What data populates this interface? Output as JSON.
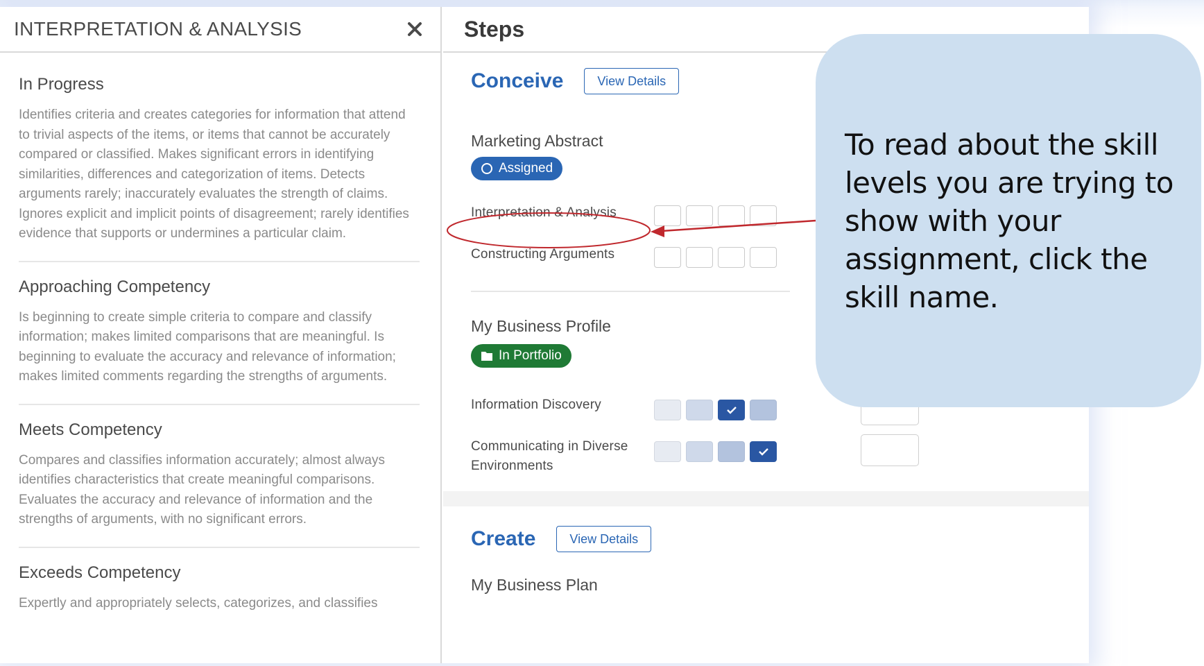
{
  "left_panel": {
    "title": "INTERPRETATION & ANALYSIS",
    "close_icon": "close-icon",
    "levels": [
      {
        "name": "In Progress",
        "description": "Identifies criteria and creates categories for information that attend to trivial aspects of the items, or items that cannot be accurately compared or classified. Makes significant errors in identifying similarities, differences and categorization of items. Detects arguments rarely; inaccurately evaluates the strength of claims. Ignores explicit and implicit points of disagreement; rarely identifies evidence that supports or undermines a particular claim."
      },
      {
        "name": "Approaching Competency",
        "description": "Is beginning to create simple criteria to compare and classify information; makes limited comparisons that are meaningful. Is beginning to evaluate the accuracy and relevance of information; makes limited comments regarding the strengths of arguments."
      },
      {
        "name": "Meets Competency",
        "description": "Compares and classifies information accurately; almost always identifies characteristics that create meaningful comparisons. Evaluates the accuracy and relevance of information and the strengths of arguments, with no significant errors."
      },
      {
        "name": "Exceeds Competency",
        "description": "Expertly and appropriately selects, categorizes, and classifies"
      }
    ]
  },
  "right_panel": {
    "title": "Steps",
    "phases": [
      {
        "title": "Conceive",
        "details_label": "View Details",
        "assignments": [
          {
            "title": "Marketing Abstract",
            "badge": "Assigned",
            "badge_icon": "circle-outline-icon",
            "skills": [
              {
                "name": "Interpretation & Analysis",
                "level": 0
              },
              {
                "name": "Constructing Arguments",
                "level": 0
              }
            ]
          },
          {
            "title": "My Business Profile",
            "badge": "In Portfolio",
            "badge_icon": "folder-icon",
            "skills": [
              {
                "name": "Information Discovery",
                "level": 3
              },
              {
                "name": "Communicating in Diverse Environments",
                "level": 4
              }
            ]
          }
        ]
      },
      {
        "title": "Create",
        "details_label": "View Details",
        "assignments": [
          {
            "title": "My Business Plan"
          }
        ]
      }
    ]
  },
  "callout": {
    "text": "To read about the skill levels you are trying to show with your assignment, click the skill name."
  },
  "colors": {
    "accent_blue": "#2a66b4",
    "portfolio_green": "#1f7a35",
    "callout_bg": "#cddff0",
    "annotation_red": "#c0282d",
    "check_blue": "#2a57a3"
  }
}
